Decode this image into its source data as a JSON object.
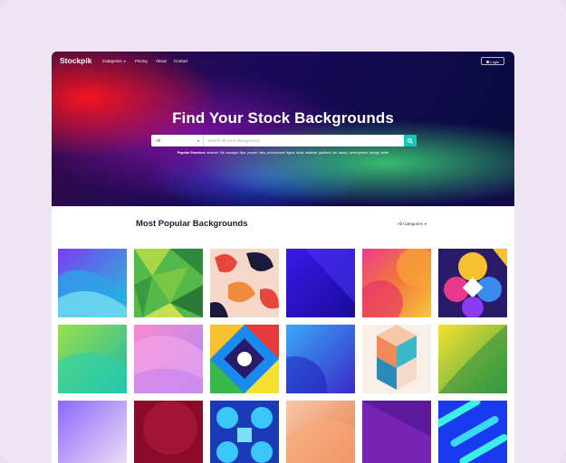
{
  "nav": {
    "logo": "Stockpik",
    "links": [
      "Categories",
      "Pricing",
      "About",
      "Contact"
    ],
    "login": "Login"
  },
  "hero": {
    "title": "Find Your Stock Backgrounds",
    "search_select": "All",
    "search_placeholder": "Search all stock Background",
    "popular_label": "Popular Searches:",
    "popular_terms": "abstract, file manager, flyer, people, idea, professional, figma, stock, abstract, gradient, ios, laptop, development, design, white"
  },
  "section": {
    "title": "Most Popular Backgrounds",
    "filter": "All Categories"
  },
  "icons": {
    "search": "search-icon",
    "user": "user-icon",
    "chevron": "chevron-down-icon"
  },
  "colors": {
    "accent": "#18c6bc",
    "title": "#1a1a33",
    "page_bg": "#efe5f2"
  }
}
